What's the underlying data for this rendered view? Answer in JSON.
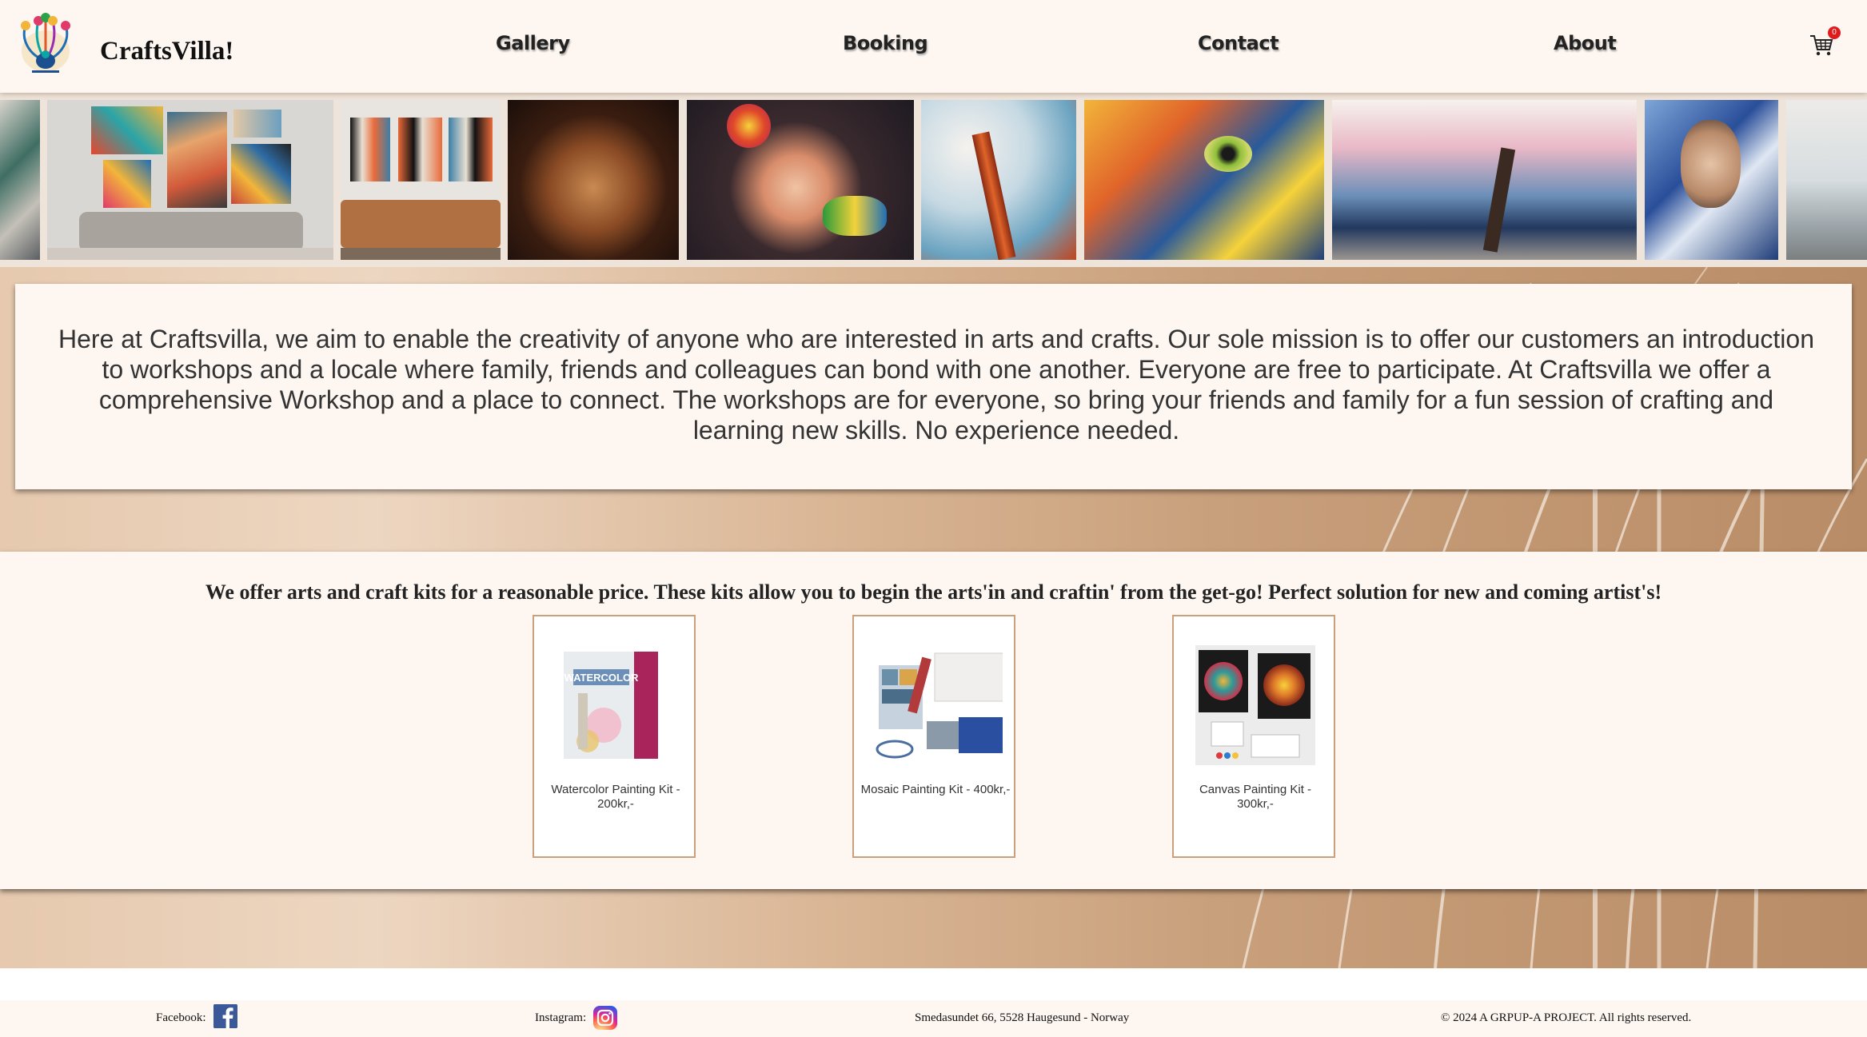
{
  "header": {
    "brand": "CraftsVilla!",
    "nav": [
      "Gallery",
      "Booking",
      "Contact",
      "About"
    ],
    "cart_count": "0"
  },
  "icons": {
    "logo": "peacock-logo",
    "cart": "shopping-cart-icon",
    "facebook": "facebook-icon",
    "instagram": "instagram-icon"
  },
  "gallery": {
    "tiles": [
      "abstract-wall-art",
      "wall-art-living-room",
      "face-art-living-room",
      "mosaic-portrait-man",
      "mosaic-woman-with-flowers",
      "white-blossom-tree",
      "mosaic-cat",
      "mosaic-cherry-tree",
      "mosaic-portrait-glasses",
      "workshop-room"
    ]
  },
  "mission": {
    "text": "Here at Craftsvilla, we aim to enable the creativity of anyone who are interested in arts and crafts. Our sole mission is to offer our customers an introduction to workshops and a locale where family, friends and colleagues can bond with one another. Everyone are free to participate. At Craftsvilla we offer a comprehensive Workshop and a place to connect. The workshops are for everyone, so bring your friends and family for a fun session of crafting and learning new skills. No experience needed."
  },
  "kits": {
    "heading": "We offer arts and craft kits for a reasonable price. These kits allow you to begin the arts'in and craftin' from the get-go! Perfect solution for new and coming artist's!",
    "items": [
      {
        "label": "Watercolor Painting Kit - 200kr,-"
      },
      {
        "label": "Mosaic Painting Kit - 400kr,-"
      },
      {
        "label": "Canvas Painting Kit - 300kr,-"
      }
    ]
  },
  "footer": {
    "facebook_label": "Facebook:",
    "instagram_label": "Instagram:",
    "address": "Smedasundet 66, 5528 Haugesund - Norway",
    "copyright": "© 2024 A GRPUP-A PROJECT. All rights reserved."
  },
  "colors": {
    "header_bg": "#fdf6f1",
    "accent": "#c9a07c",
    "badge": "#e01b1b"
  }
}
